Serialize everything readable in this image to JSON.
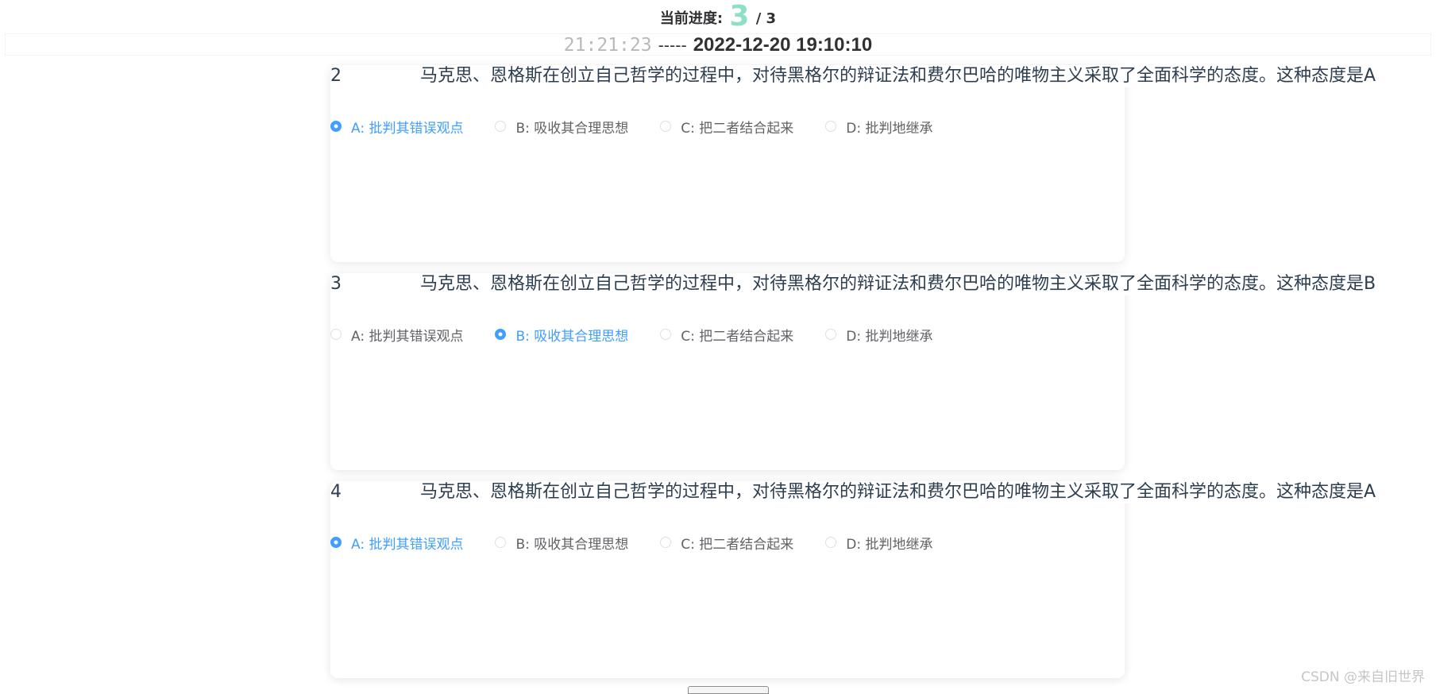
{
  "progress": {
    "label": "当前进度:",
    "current": "3",
    "total_text": "/ 3"
  },
  "timer": {
    "clock": "21:21:23",
    "separator": "-----",
    "deadline": "2022-12-20 19:10:10"
  },
  "questions": [
    {
      "number": "2",
      "stem": "马克思、恩格斯在创立自己哲学的过程中，对待黑格尔的辩证法和费尔巴哈的唯物主义采取了全面科学的态度。这种态度是A",
      "selected": "A",
      "options": [
        {
          "label": "A: 批判其错误观点",
          "checked": true
        },
        {
          "label": "B: 吸收其合理思想",
          "checked": false
        },
        {
          "label": "C: 把二者结合起来",
          "checked": false
        },
        {
          "label": "D: 批判地继承",
          "checked": false
        }
      ]
    },
    {
      "number": "3",
      "stem": "马克思、恩格斯在创立自己哲学的过程中，对待黑格尔的辩证法和费尔巴哈的唯物主义采取了全面科学的态度。这种态度是B",
      "selected": "B",
      "options": [
        {
          "label": "A: 批判其错误观点",
          "checked": false
        },
        {
          "label": "B: 吸收其合理思想",
          "checked": true
        },
        {
          "label": "C: 把二者结合起来",
          "checked": false
        },
        {
          "label": "D: 批判地继承",
          "checked": false
        }
      ]
    },
    {
      "number": "4",
      "stem": "马克思、恩格斯在创立自己哲学的过程中，对待黑格尔的辩证法和费尔巴哈的唯物主义采取了全面科学的态度。这种态度是A",
      "selected": "A",
      "options": [
        {
          "label": "A: 批判其错误观点",
          "checked": true
        },
        {
          "label": "B: 吸收其合理思想",
          "checked": false
        },
        {
          "label": "C: 把二者结合起来",
          "checked": false
        },
        {
          "label": "D: 批判地继承",
          "checked": false
        }
      ]
    }
  ],
  "watermark": "CSDN @来自旧世界",
  "colors": {
    "accent": "#409eff",
    "progress_number": "#8de0c7",
    "text": "#2c3e50",
    "option_text": "#606266",
    "clock": "#b7b9bd"
  }
}
